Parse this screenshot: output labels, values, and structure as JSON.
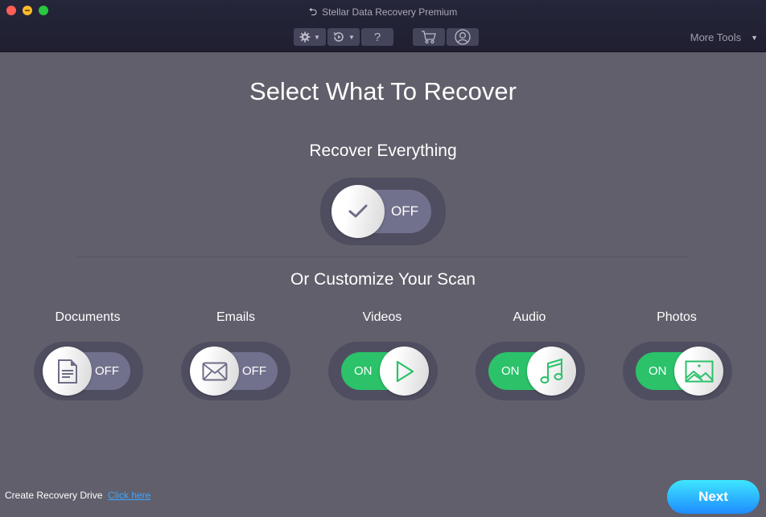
{
  "window": {
    "title": "Stellar Data Recovery Premium",
    "title_icon": "back-arrow-icon"
  },
  "toolbar": {
    "buttons": [
      {
        "name": "settings",
        "icon": "gear-icon",
        "has_dropdown": true
      },
      {
        "name": "history",
        "icon": "history-icon",
        "has_dropdown": true
      },
      {
        "name": "help",
        "icon": "question-icon",
        "label": "?"
      },
      {
        "name": "cart",
        "icon": "cart-icon"
      },
      {
        "name": "account",
        "icon": "user-icon"
      }
    ],
    "more_tools_label": "More Tools"
  },
  "main": {
    "title": "Select What To Recover",
    "recover_everything": {
      "label": "Recover Everything",
      "state": "OFF",
      "icon": "check-icon"
    },
    "customize_label": "Or Customize Your Scan",
    "categories": [
      {
        "label": "Documents",
        "state": "OFF",
        "icon": "document-icon"
      },
      {
        "label": "Emails",
        "state": "OFF",
        "icon": "envelope-icon"
      },
      {
        "label": "Videos",
        "state": "ON",
        "icon": "play-icon"
      },
      {
        "label": "Audio",
        "state": "ON",
        "icon": "music-note-icon"
      },
      {
        "label": "Photos",
        "state": "ON",
        "icon": "image-icon"
      }
    ]
  },
  "footer": {
    "recovery_drive_label": "Create Recovery Drive",
    "recovery_drive_link": "Click here",
    "next_label": "Next"
  },
  "colors": {
    "background": "#605f6b",
    "on_green": "#2bc26a",
    "off_track": "#72718d",
    "link_blue": "#3ea6ff",
    "next_gradient_top": "#3ee6ff",
    "next_gradient_bottom": "#1e8bff"
  }
}
